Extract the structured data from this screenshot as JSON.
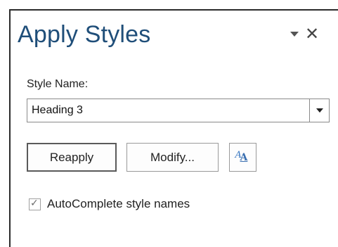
{
  "pane": {
    "title": "Apply Styles",
    "menu_icon": "dropdown-triangle",
    "close_icon": "close-x",
    "close_glyph": "✕"
  },
  "style_name": {
    "label": "Style Name:",
    "value": "Heading 3",
    "dropdown_icon": "chevron-down"
  },
  "buttons": {
    "reapply": "Reapply",
    "modify": "Modify...",
    "styles_icon": "styles-pane-icon",
    "styles_glyph_a1": "A",
    "styles_glyph_a2": "A"
  },
  "autocomplete": {
    "label": "AutoComplete style names",
    "checked": true,
    "check_glyph": "✓"
  },
  "colors": {
    "title": "#1f4e79",
    "accent_icon": "#3a78c2"
  }
}
